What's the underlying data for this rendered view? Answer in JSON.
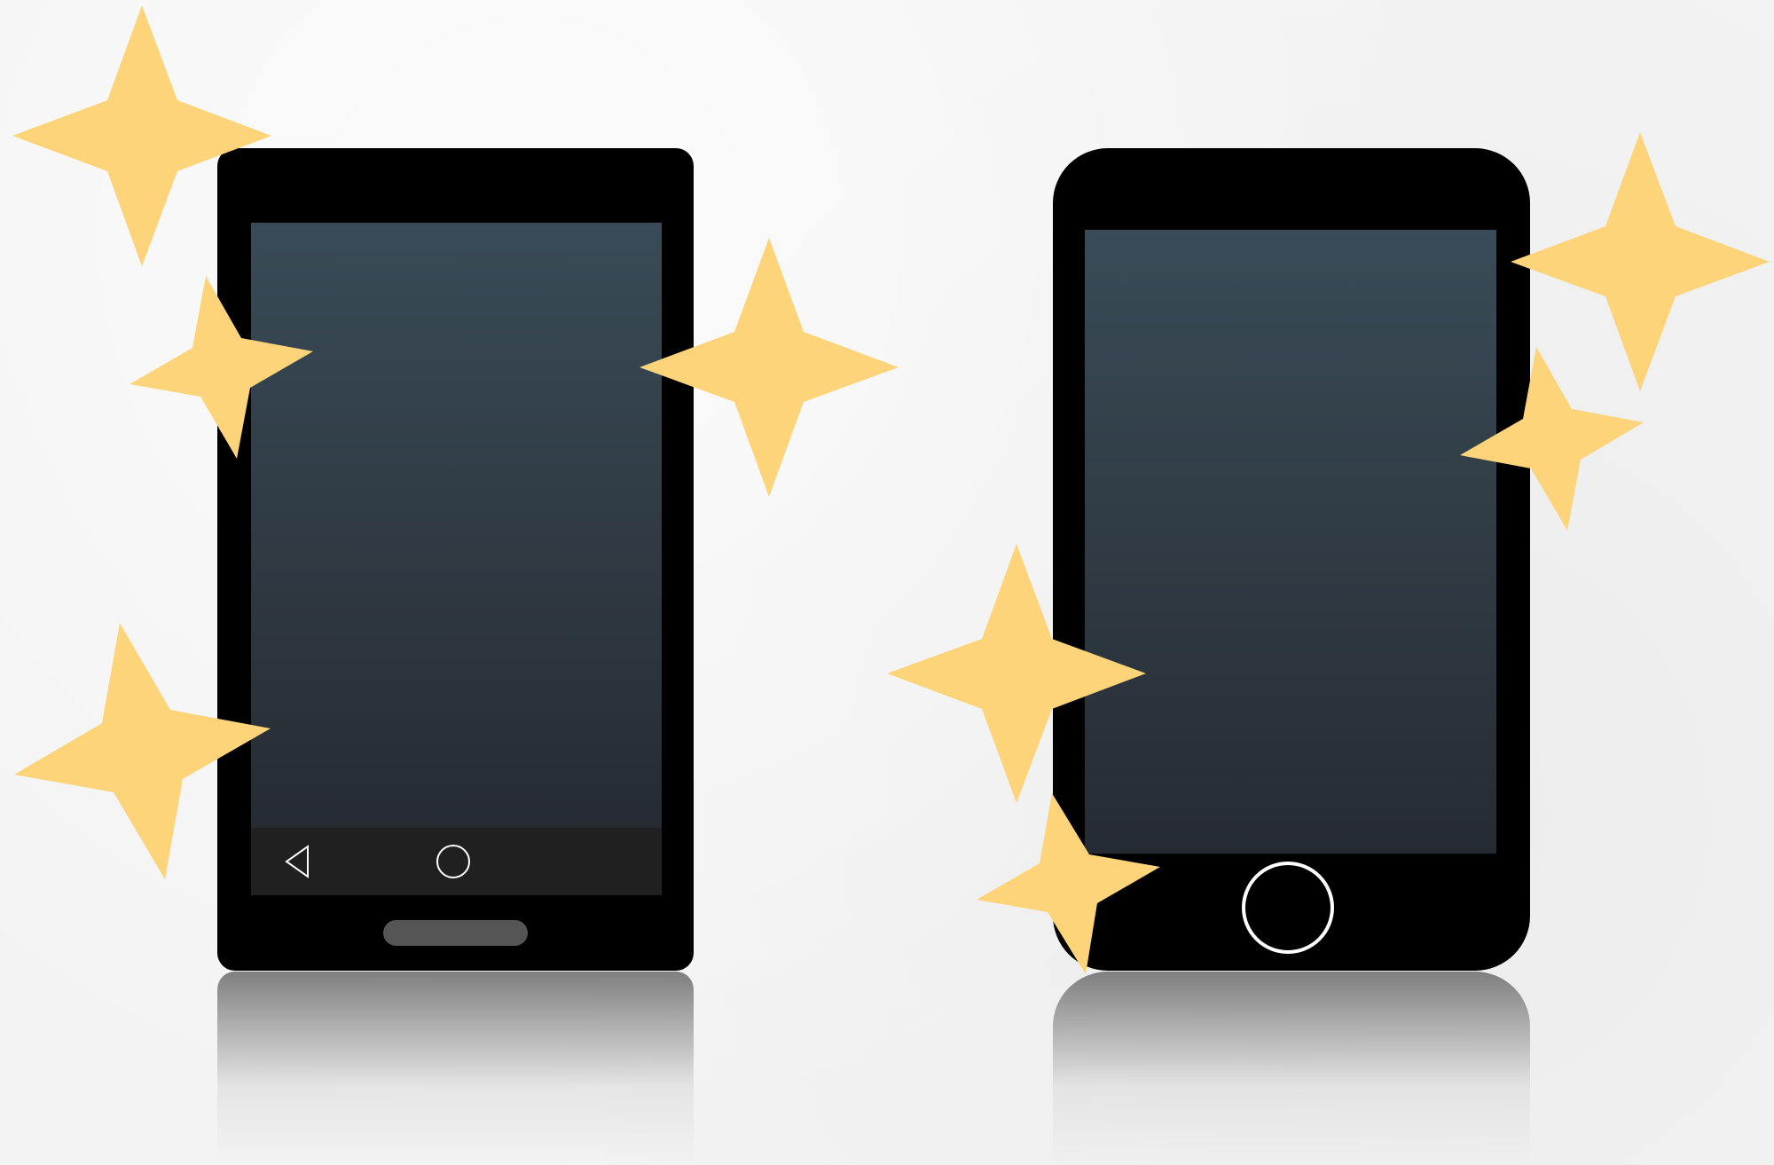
{
  "colors": {
    "background": "#f3f3f3",
    "device_body": "#000000",
    "screen_top": "#394b57",
    "screen_bottom": "#262b32",
    "android_navbar": "#202020",
    "sparkle": "#fdd47a"
  },
  "devices": [
    {
      "name": "android-phone",
      "nav_icons": [
        "back-triangle-icon",
        "home-circle-icon"
      ],
      "has_speaker_bar": true
    },
    {
      "name": "iphone",
      "nav_icons": [
        "home-button-icon"
      ],
      "has_speaker_bar": false
    }
  ],
  "sparkles": [
    {
      "icon": "sparkle-icon"
    },
    {
      "icon": "sparkle-icon"
    },
    {
      "icon": "sparkle-icon"
    },
    {
      "icon": "sparkle-icon"
    },
    {
      "icon": "sparkle-icon"
    },
    {
      "icon": "sparkle-icon"
    },
    {
      "icon": "sparkle-icon"
    },
    {
      "icon": "sparkle-icon"
    },
    {
      "icon": "sparkle-icon"
    }
  ]
}
